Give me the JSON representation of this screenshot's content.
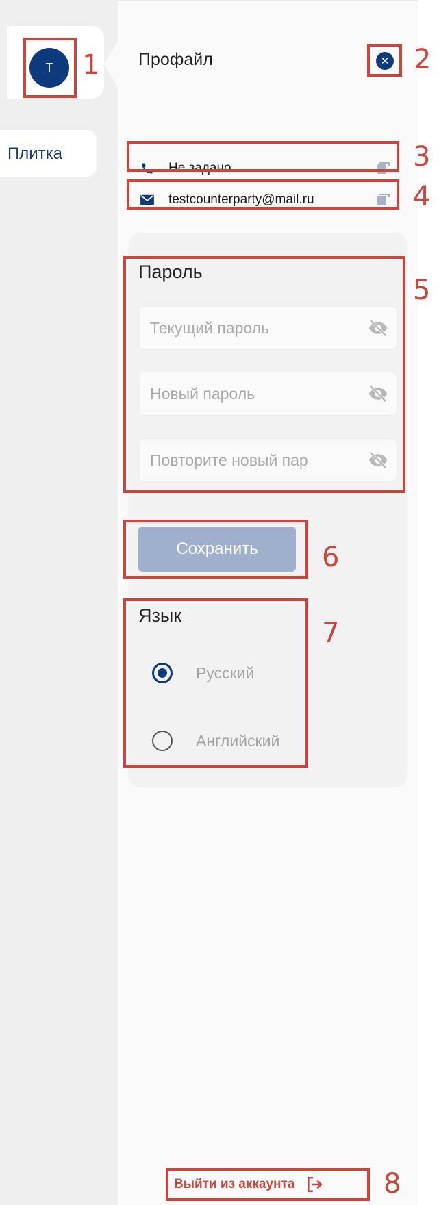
{
  "sidebar": {
    "avatar_initial": "T",
    "tile_label": "Плитка"
  },
  "panel": {
    "title": "Профайл",
    "close_icon": "close-circle-icon"
  },
  "contacts": {
    "phone": {
      "icon": "phone-icon",
      "value": "Не задано"
    },
    "email": {
      "icon": "mail-icon",
      "value": "testcounterparty@mail.ru"
    }
  },
  "password": {
    "title": "Пароль",
    "current_placeholder": "Текущий пароль",
    "new_placeholder": "Новый пароль",
    "repeat_placeholder": "Повторите новый пар"
  },
  "save_label": "Сохранить",
  "language": {
    "title": "Язык",
    "options": [
      {
        "label": "Русский",
        "selected": true
      },
      {
        "label": "Английский",
        "selected": false
      }
    ]
  },
  "logout_label": "Выйти из аккаунта",
  "annotations": [
    "1",
    "2",
    "3",
    "4",
    "5",
    "6",
    "7",
    "8"
  ],
  "colors": {
    "brand": "#0c3a7c",
    "annotation": "#c9463d",
    "save_disabled": "#9fb0cc",
    "logout": "#c8463d"
  }
}
